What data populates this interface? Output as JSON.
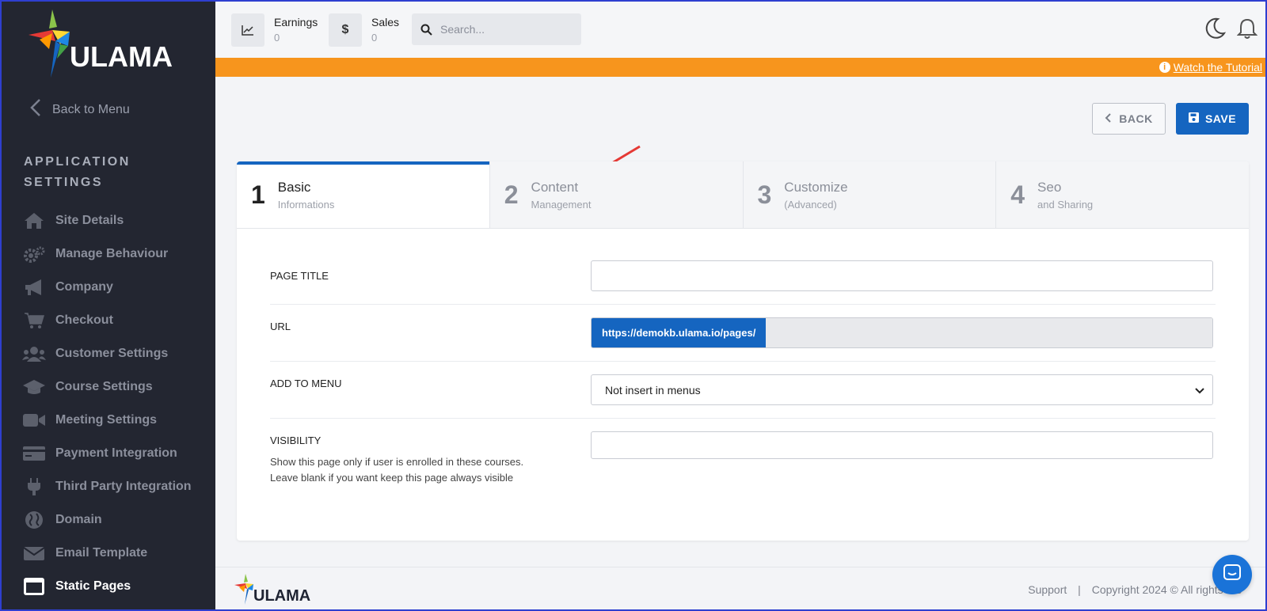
{
  "brand": {
    "name": "ULAMA"
  },
  "sidebar": {
    "back_label": "Back to Menu",
    "section_title_line1": "APPLICATION",
    "section_title_line2": "SETTINGS",
    "items": [
      {
        "label": "Site Details",
        "icon": "home-icon"
      },
      {
        "label": "Manage Behaviour",
        "icon": "gears-icon"
      },
      {
        "label": "Company",
        "icon": "megaphone-icon"
      },
      {
        "label": "Checkout",
        "icon": "cart-icon"
      },
      {
        "label": "Customer Settings",
        "icon": "users-icon"
      },
      {
        "label": "Course Settings",
        "icon": "graduation-cap-icon"
      },
      {
        "label": "Meeting Settings",
        "icon": "video-camera-icon"
      },
      {
        "label": "Payment Integration",
        "icon": "credit-card-icon"
      },
      {
        "label": "Third Party Integration",
        "icon": "plug-icon"
      },
      {
        "label": "Domain",
        "icon": "globe-icon"
      },
      {
        "label": "Email Template",
        "icon": "envelope-icon"
      },
      {
        "label": "Static Pages",
        "icon": "window-icon",
        "active": true
      }
    ]
  },
  "topbar": {
    "earnings_label": "Earnings",
    "earnings_value": "0",
    "sales_label": "Sales",
    "sales_value": "0",
    "currency_symbol": "$",
    "search_placeholder": "Search..."
  },
  "banner": {
    "link_text": "Watch the Tutorial",
    "color": "#f7951d"
  },
  "actions": {
    "back_label": "BACK",
    "save_label": "SAVE",
    "accent": "#1565c0"
  },
  "steps": [
    {
      "num": "1",
      "title": "Basic",
      "subtitle": "Informations",
      "active": true
    },
    {
      "num": "2",
      "title": "Content",
      "subtitle": "Management"
    },
    {
      "num": "3",
      "title": "Customize",
      "subtitle": "(Advanced)"
    },
    {
      "num": "4",
      "title": "Seo",
      "subtitle": "and Sharing"
    }
  ],
  "form": {
    "page_title_label": "PAGE TITLE",
    "page_title_value": "",
    "url_label": "URL",
    "url_prefix": "https://demokb.ulama.io/pages/",
    "url_value": "",
    "menu_label": "ADD TO MENU",
    "menu_selected": "Not insert in menus",
    "visibility_label": "VISIBILITY",
    "visibility_help_1": "Show this page only if user is enrolled in these courses.",
    "visibility_help_2": "Leave blank if you want keep this page always visible",
    "visibility_value": ""
  },
  "footer": {
    "support_label": "Support",
    "separator": "|",
    "copyright": "Copyright 2024 © All rights res"
  }
}
